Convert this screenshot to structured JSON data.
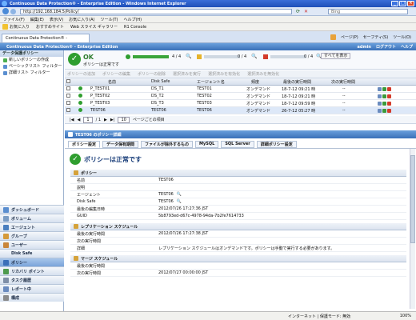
{
  "browser": {
    "window_title": "Continuous Data Protection® - Enterprise Edition - Windows Internet Explorer",
    "url": "http://192.168.184.5/Policy/",
    "search_placeholder": "Bing",
    "menu": [
      "ファイル(F)",
      "編集(E)",
      "表示(V)",
      "お気に入り(A)",
      "ツール(T)",
      "ヘルプ(H)"
    ],
    "favorites": [
      "お気に入り",
      "おすすめサイト",
      "Web スライス ギャラリー",
      "R1 Console"
    ],
    "tab_title": "Continuous Data Protection® - Enterprise Edition",
    "toolbar_right": [
      "ページ(P)",
      "セーフティ(S)",
      "ツール(O)"
    ],
    "status_text": "インターネット | 保護モード: 無効",
    "zoom": "100%"
  },
  "app": {
    "title": "Continuous Data Protection® - Enterprise Edition",
    "header_links": [
      "admin",
      "ログアウト",
      "ヘルプ"
    ]
  },
  "sidebar": {
    "title": "データ保護ポリシー",
    "items": [
      "新しいポリシーの作成",
      "ベーシックリスト フィルター",
      "詳細リスト フィルター"
    ],
    "nav": [
      "ダッシュボード",
      "ボリューム",
      "エージェント",
      "グループ",
      "ユーザー",
      "Disk Safe",
      "ポリシー",
      "リカバリ ポイント",
      "タスク履歴",
      "レポート中",
      "構成"
    ],
    "active_nav": "ポリシー"
  },
  "summary": {
    "status": "OK",
    "status_sub": "ポリシーは正常です",
    "counts": [
      "4 / 4",
      "0 / 4",
      "0 / 4"
    ],
    "show_all_label": "すべてを表示"
  },
  "actions": [
    "ポリシーの追加",
    "ポリシーの編集",
    "ポリシーの削除",
    "選択済みを実行",
    "選択済みを有効化",
    "選択済みを無効化"
  ],
  "grid": {
    "headers": [
      "名前",
      "Disk Safe",
      "エージェント名",
      "頻度",
      "最後の実行時間",
      "次の実行時間"
    ],
    "rows": [
      {
        "name": "P_TEST01",
        "disksafe": "DS_T1",
        "agent": "TEST01",
        "freq": "オンデマンド",
        "last": "18-7-12 09:21 時",
        "next": "--"
      },
      {
        "name": "P_TEST02",
        "disksafe": "DS_T2",
        "agent": "TEST02",
        "freq": "オンデマンド",
        "last": "18-7-12 09:21 時",
        "next": "--"
      },
      {
        "name": "P_TEST03",
        "disksafe": "DS_T3",
        "agent": "TEST03",
        "freq": "オンデマンド",
        "last": "18-7-12 09:59 時",
        "next": "--"
      },
      {
        "name": "TEST06",
        "disksafe": "TEST06",
        "agent": "TEST06",
        "freq": "オンデマンド",
        "last": "26-7-12 05:27 時",
        "next": "--"
      }
    ],
    "page_input": "1",
    "page_total": "/ 1",
    "page_size": "10",
    "page_size_label": "ページごとの項目"
  },
  "detail": {
    "title": "TEST06 のポリシー詳細",
    "tabs": [
      "ポリシー設定",
      "データ保有期間",
      "ファイルが除外するもの",
      "MySQL",
      "SQL Server",
      "詳細ポリシー設定"
    ],
    "status_text": "ポリシーは正常です",
    "sections": [
      {
        "title": "ポリシー",
        "rows": [
          {
            "k": "名前",
            "v": "TEST06"
          },
          {
            "k": "説明",
            "v": ""
          },
          {
            "k": "エージェント",
            "v": "TEST06"
          },
          {
            "k": "Disk Safe",
            "v": "TEST06"
          },
          {
            "k": "最後の編集日時",
            "v": "2012/07/26 17:27:36 JST"
          },
          {
            "k": "GUID",
            "v": "5b8793ed-d67c-4978-94da-7b2fe7614733"
          }
        ]
      },
      {
        "title": "レプリケーション スケジュール",
        "rows": [
          {
            "k": "最後の実行時間",
            "v": "2012/07/26 17:27:38 JST"
          },
          {
            "k": "次の実行時間",
            "v": ""
          },
          {
            "k": "詳細",
            "v": "レプリケーション スケジュールはオンデマンドです。ポリシーは手動で実行する必要があります。"
          }
        ]
      },
      {
        "title": "マージ スケジュール",
        "rows": [
          {
            "k": "最後の実行時間",
            "v": ""
          },
          {
            "k": "次の実行時間",
            "v": "2012/07/27 00:00:00 JST"
          }
        ]
      }
    ]
  },
  "colors": {
    "ok_green": "#2f9e2f",
    "title_blue": "#1e4fb8",
    "header_blue": "#3a70b8"
  }
}
